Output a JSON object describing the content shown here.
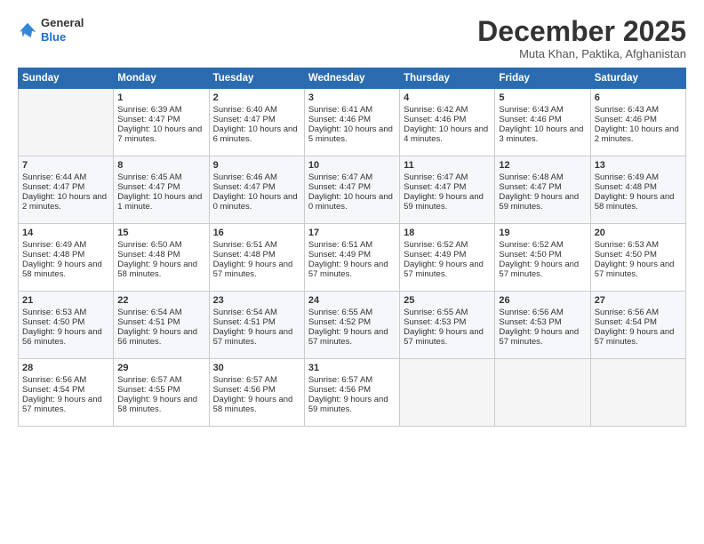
{
  "header": {
    "logo_general": "General",
    "logo_blue": "Blue",
    "title": "December 2025",
    "location": "Muta Khan, Paktika, Afghanistan"
  },
  "weekdays": [
    "Sunday",
    "Monday",
    "Tuesday",
    "Wednesday",
    "Thursday",
    "Friday",
    "Saturday"
  ],
  "weeks": [
    [
      {
        "day": "",
        "empty": true
      },
      {
        "day": "1",
        "sunrise": "Sunrise: 6:39 AM",
        "sunset": "Sunset: 4:47 PM",
        "daylight": "Daylight: 10 hours and 7 minutes."
      },
      {
        "day": "2",
        "sunrise": "Sunrise: 6:40 AM",
        "sunset": "Sunset: 4:47 PM",
        "daylight": "Daylight: 10 hours and 6 minutes."
      },
      {
        "day": "3",
        "sunrise": "Sunrise: 6:41 AM",
        "sunset": "Sunset: 4:46 PM",
        "daylight": "Daylight: 10 hours and 5 minutes."
      },
      {
        "day": "4",
        "sunrise": "Sunrise: 6:42 AM",
        "sunset": "Sunset: 4:46 PM",
        "daylight": "Daylight: 10 hours and 4 minutes."
      },
      {
        "day": "5",
        "sunrise": "Sunrise: 6:43 AM",
        "sunset": "Sunset: 4:46 PM",
        "daylight": "Daylight: 10 hours and 3 minutes."
      },
      {
        "day": "6",
        "sunrise": "Sunrise: 6:43 AM",
        "sunset": "Sunset: 4:46 PM",
        "daylight": "Daylight: 10 hours and 2 minutes."
      }
    ],
    [
      {
        "day": "7",
        "sunrise": "Sunrise: 6:44 AM",
        "sunset": "Sunset: 4:47 PM",
        "daylight": "Daylight: 10 hours and 2 minutes."
      },
      {
        "day": "8",
        "sunrise": "Sunrise: 6:45 AM",
        "sunset": "Sunset: 4:47 PM",
        "daylight": "Daylight: 10 hours and 1 minute."
      },
      {
        "day": "9",
        "sunrise": "Sunrise: 6:46 AM",
        "sunset": "Sunset: 4:47 PM",
        "daylight": "Daylight: 10 hours and 0 minutes."
      },
      {
        "day": "10",
        "sunrise": "Sunrise: 6:47 AM",
        "sunset": "Sunset: 4:47 PM",
        "daylight": "Daylight: 10 hours and 0 minutes."
      },
      {
        "day": "11",
        "sunrise": "Sunrise: 6:47 AM",
        "sunset": "Sunset: 4:47 PM",
        "daylight": "Daylight: 9 hours and 59 minutes."
      },
      {
        "day": "12",
        "sunrise": "Sunrise: 6:48 AM",
        "sunset": "Sunset: 4:47 PM",
        "daylight": "Daylight: 9 hours and 59 minutes."
      },
      {
        "day": "13",
        "sunrise": "Sunrise: 6:49 AM",
        "sunset": "Sunset: 4:48 PM",
        "daylight": "Daylight: 9 hours and 58 minutes."
      }
    ],
    [
      {
        "day": "14",
        "sunrise": "Sunrise: 6:49 AM",
        "sunset": "Sunset: 4:48 PM",
        "daylight": "Daylight: 9 hours and 58 minutes."
      },
      {
        "day": "15",
        "sunrise": "Sunrise: 6:50 AM",
        "sunset": "Sunset: 4:48 PM",
        "daylight": "Daylight: 9 hours and 58 minutes."
      },
      {
        "day": "16",
        "sunrise": "Sunrise: 6:51 AM",
        "sunset": "Sunset: 4:48 PM",
        "daylight": "Daylight: 9 hours and 57 minutes."
      },
      {
        "day": "17",
        "sunrise": "Sunrise: 6:51 AM",
        "sunset": "Sunset: 4:49 PM",
        "daylight": "Daylight: 9 hours and 57 minutes."
      },
      {
        "day": "18",
        "sunrise": "Sunrise: 6:52 AM",
        "sunset": "Sunset: 4:49 PM",
        "daylight": "Daylight: 9 hours and 57 minutes."
      },
      {
        "day": "19",
        "sunrise": "Sunrise: 6:52 AM",
        "sunset": "Sunset: 4:50 PM",
        "daylight": "Daylight: 9 hours and 57 minutes."
      },
      {
        "day": "20",
        "sunrise": "Sunrise: 6:53 AM",
        "sunset": "Sunset: 4:50 PM",
        "daylight": "Daylight: 9 hours and 57 minutes."
      }
    ],
    [
      {
        "day": "21",
        "sunrise": "Sunrise: 6:53 AM",
        "sunset": "Sunset: 4:50 PM",
        "daylight": "Daylight: 9 hours and 56 minutes."
      },
      {
        "day": "22",
        "sunrise": "Sunrise: 6:54 AM",
        "sunset": "Sunset: 4:51 PM",
        "daylight": "Daylight: 9 hours and 56 minutes."
      },
      {
        "day": "23",
        "sunrise": "Sunrise: 6:54 AM",
        "sunset": "Sunset: 4:51 PM",
        "daylight": "Daylight: 9 hours and 57 minutes."
      },
      {
        "day": "24",
        "sunrise": "Sunrise: 6:55 AM",
        "sunset": "Sunset: 4:52 PM",
        "daylight": "Daylight: 9 hours and 57 minutes."
      },
      {
        "day": "25",
        "sunrise": "Sunrise: 6:55 AM",
        "sunset": "Sunset: 4:53 PM",
        "daylight": "Daylight: 9 hours and 57 minutes."
      },
      {
        "day": "26",
        "sunrise": "Sunrise: 6:56 AM",
        "sunset": "Sunset: 4:53 PM",
        "daylight": "Daylight: 9 hours and 57 minutes."
      },
      {
        "day": "27",
        "sunrise": "Sunrise: 6:56 AM",
        "sunset": "Sunset: 4:54 PM",
        "daylight": "Daylight: 9 hours and 57 minutes."
      }
    ],
    [
      {
        "day": "28",
        "sunrise": "Sunrise: 6:56 AM",
        "sunset": "Sunset: 4:54 PM",
        "daylight": "Daylight: 9 hours and 57 minutes."
      },
      {
        "day": "29",
        "sunrise": "Sunrise: 6:57 AM",
        "sunset": "Sunset: 4:55 PM",
        "daylight": "Daylight: 9 hours and 58 minutes."
      },
      {
        "day": "30",
        "sunrise": "Sunrise: 6:57 AM",
        "sunset": "Sunset: 4:56 PM",
        "daylight": "Daylight: 9 hours and 58 minutes."
      },
      {
        "day": "31",
        "sunrise": "Sunrise: 6:57 AM",
        "sunset": "Sunset: 4:56 PM",
        "daylight": "Daylight: 9 hours and 59 minutes."
      },
      {
        "day": "",
        "empty": true
      },
      {
        "day": "",
        "empty": true
      },
      {
        "day": "",
        "empty": true
      }
    ]
  ]
}
